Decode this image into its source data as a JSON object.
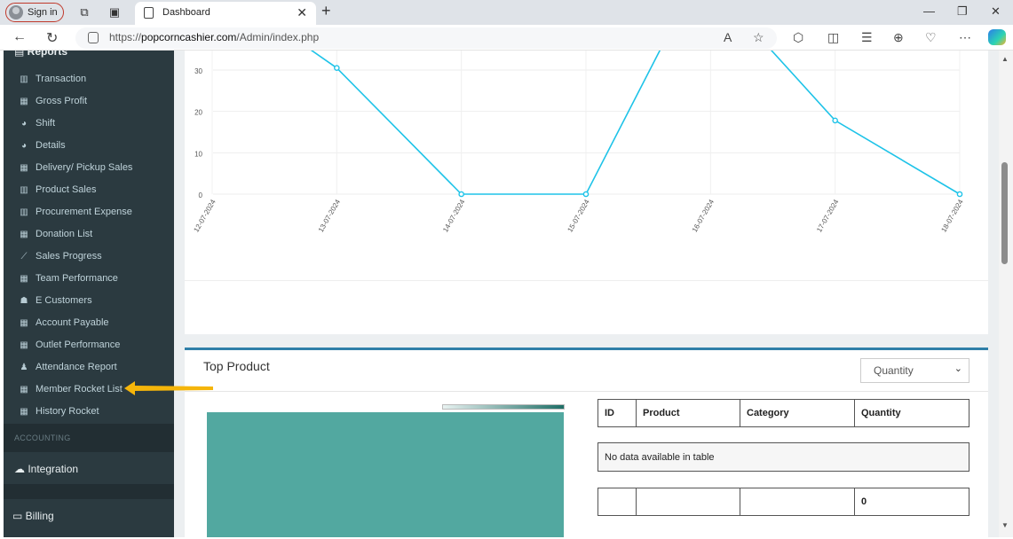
{
  "browser": {
    "signin_label": "Sign in",
    "tab_title": "Dashboard",
    "url_prefix": "https://",
    "url_domain": "popcorncashier.com",
    "url_path": "/Admin/index.php"
  },
  "sidebar": {
    "header": "Reports",
    "items": [
      {
        "label": "Transaction",
        "icon": "bar-chart-icon"
      },
      {
        "label": "Gross Profit",
        "icon": "table-icon"
      },
      {
        "label": "Shift",
        "icon": "pie-chart-icon"
      },
      {
        "label": "Details",
        "icon": "pie-chart-icon"
      },
      {
        "label": "Delivery/ Pickup Sales",
        "icon": "table-icon"
      },
      {
        "label": "Product Sales",
        "icon": "bar-chart-icon"
      },
      {
        "label": "Procurement Expense",
        "icon": "bar-chart-icon"
      },
      {
        "label": "Donation List",
        "icon": "table-icon"
      },
      {
        "label": "Sales Progress",
        "icon": "line-chart-icon"
      },
      {
        "label": "Team Performance",
        "icon": "table-icon"
      },
      {
        "label": "E Customers",
        "icon": "users-icon"
      },
      {
        "label": "Account Payable",
        "icon": "table-icon"
      },
      {
        "label": "Outlet Performance",
        "icon": "table-icon"
      },
      {
        "label": "Attendance Report",
        "icon": "person-icon"
      },
      {
        "label": "Member Rocket List",
        "icon": "table-icon"
      },
      {
        "label": "History Rocket",
        "icon": "table-icon"
      }
    ],
    "accounting_label": "ACCOUNTING",
    "integration_label": "Integration",
    "billing_label": "Billing"
  },
  "chart_data": {
    "type": "line",
    "categories": [
      "12-07-2024",
      "13-07-2024",
      "14-07-2024",
      "15-07-2024",
      "16-07-2024",
      "17-07-2024",
      "18-07-2024"
    ],
    "x_positions": [
      1,
      2,
      3,
      4,
      5,
      6,
      7
    ],
    "points": [
      {
        "x": 1.5,
        "y": 41
      },
      {
        "x": 2,
        "y": 30.5
      },
      {
        "x": 3,
        "y": 0
      },
      {
        "x": 4,
        "y": 0
      },
      {
        "x": 4.7,
        "y": 41
      },
      {
        "x": 5.3,
        "y": 41
      },
      {
        "x": 6,
        "y": 17.8
      },
      {
        "x": 7,
        "y": 0
      }
    ],
    "y_ticks": [
      0,
      10,
      20,
      30
    ],
    "ylim": [
      0,
      34
    ],
    "color": "#1ec3e8",
    "grid": true
  },
  "top_product": {
    "title": "Top Product",
    "select_value": "Quantity",
    "table_headers": [
      "ID",
      "Product",
      "Category",
      "Quantity"
    ],
    "no_data": "No data available in table",
    "footer_total": "0"
  }
}
